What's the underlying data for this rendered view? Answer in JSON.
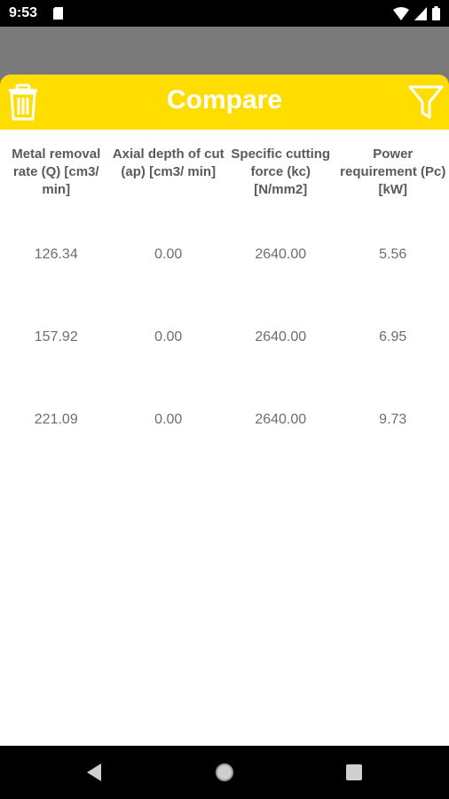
{
  "status_bar": {
    "time": "9:53"
  },
  "app_bar": {
    "title": "Compare"
  },
  "table": {
    "headers": [
      "Metal removal rate (Q) [cm3/ min]",
      "Axial depth of cut (ap) [cm3/ min]",
      "Specific cutting force (kc) [N/mm2]",
      "Power requirement (Pc) [kW]"
    ],
    "rows": [
      [
        "126.34",
        "0.00",
        "2640.00",
        "5.56"
      ],
      [
        "157.92",
        "0.00",
        "2640.00",
        "6.95"
      ],
      [
        "221.09",
        "0.00",
        "2640.00",
        "9.73"
      ]
    ]
  },
  "colors": {
    "accent": "#ffdd00",
    "title_text": "#ffffff",
    "band": "#7a7a7a"
  },
  "icons": {
    "left": "trash-icon",
    "right": "filter-icon"
  }
}
